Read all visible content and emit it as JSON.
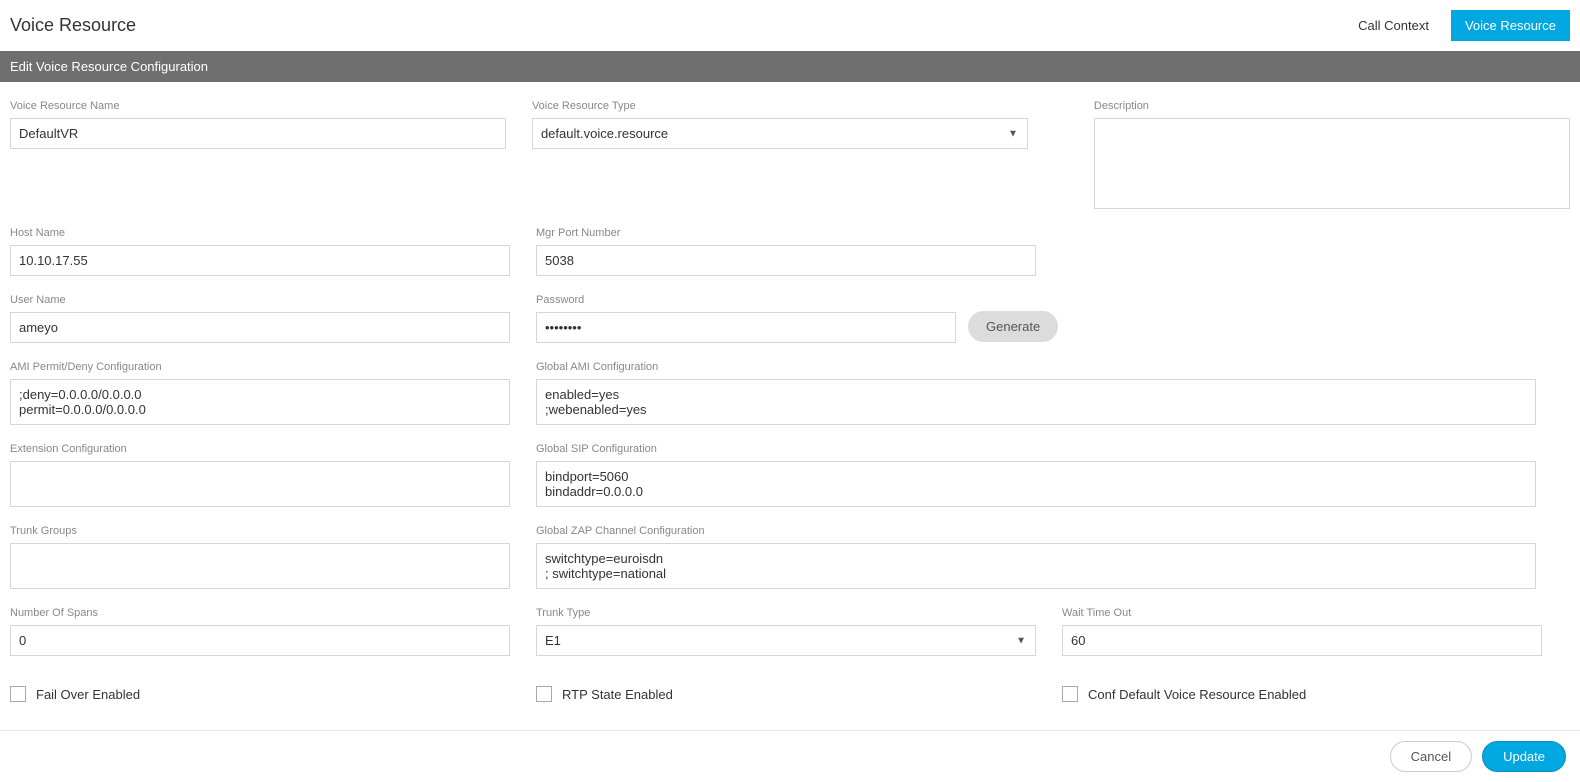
{
  "header": {
    "title": "Voice Resource",
    "tabs": {
      "call_context": "Call Context",
      "voice_resource": "Voice Resource"
    }
  },
  "section": {
    "title": "Edit Voice Resource Configuration"
  },
  "labels": {
    "voice_resource_name": "Voice Resource Name",
    "voice_resource_type": "Voice Resource Type",
    "description": "Description",
    "host_name": "Host Name",
    "mgr_port_number": "Mgr Port Number",
    "user_name": "User Name",
    "password": "Password",
    "generate": "Generate",
    "ami_permit_deny": "AMI Permit/Deny Configuration",
    "global_ami": "Global AMI Configuration",
    "extension_config": "Extension Configuration",
    "global_sip": "Global SIP Configuration",
    "trunk_groups": "Trunk Groups",
    "global_zap": "Global ZAP Channel Configuration",
    "number_of_spans": "Number Of Spans",
    "trunk_type": "Trunk Type",
    "wait_time_out": "Wait Time Out",
    "fail_over_enabled": "Fail Over Enabled",
    "rtp_state_enabled": "RTP State Enabled",
    "conf_default_vr_enabled": "Conf Default Voice Resource Enabled"
  },
  "values": {
    "voice_resource_name": "DefaultVR",
    "voice_resource_type": "default.voice.resource",
    "description": "",
    "host_name": "10.10.17.55",
    "mgr_port_number": "5038",
    "user_name": "ameyo",
    "password": "••••••••",
    "ami_permit_deny": ";deny=0.0.0.0/0.0.0.0\npermit=0.0.0.0/0.0.0.0",
    "global_ami": "enabled=yes\n;webenabled=yes",
    "extension_config": "",
    "global_sip": "bindport=5060\nbindaddr=0.0.0.0",
    "trunk_groups": "",
    "global_zap": "switchtype=euroisdn\n; switchtype=national",
    "number_of_spans": "0",
    "trunk_type": "E1",
    "wait_time_out": "60",
    "fail_over_enabled": false,
    "rtp_state_enabled": false,
    "conf_default_vr_enabled": false
  },
  "footer": {
    "cancel": "Cancel",
    "update": "Update"
  }
}
